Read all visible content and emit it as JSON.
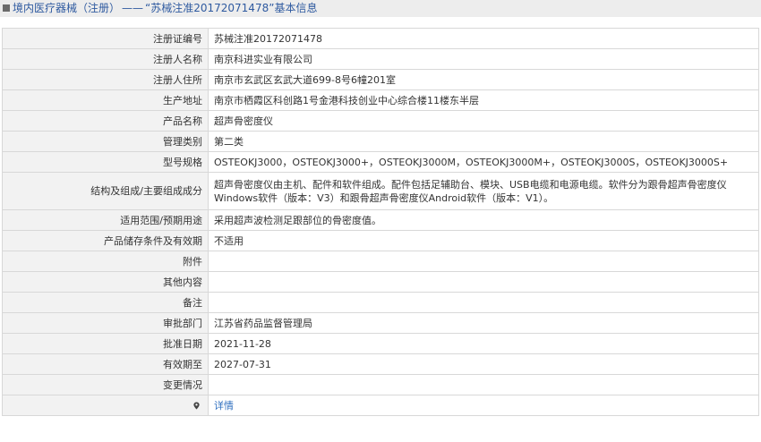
{
  "header": {
    "section": "境内医疗器械（注册）",
    "dash": "——",
    "reg_no": "“苏械注准20172071478”",
    "suffix": "基本信息"
  },
  "rows": [
    {
      "label": "注册证编号",
      "value": "苏械注准20172071478"
    },
    {
      "label": "注册人名称",
      "value": "南京科进实业有限公司"
    },
    {
      "label": "注册人住所",
      "value": "南京市玄武区玄武大道699-8号6幢201室"
    },
    {
      "label": "生产地址",
      "value": "南京市栖霞区科创路1号金港科技创业中心综合楼11楼东半层"
    },
    {
      "label": "产品名称",
      "value": "超声骨密度仪"
    },
    {
      "label": "管理类别",
      "value": "第二类"
    },
    {
      "label": "型号规格",
      "value": "OSTEOKJ3000，OSTEOKJ3000+，OSTEOKJ3000M，OSTEOKJ3000M+，OSTEOKJ3000S，OSTEOKJ3000S+"
    },
    {
      "label": "结构及组成/主要组成成分",
      "value": "超声骨密度仪由主机、配件和软件组成。配件包括足辅助台、模块、USB电缆和电源电缆。软件分为跟骨超声骨密度仪Windows软件（版本：V3）和跟骨超声骨密度仪Android软件（版本：V1）。"
    },
    {
      "label": "适用范围/预期用途",
      "value": "采用超声波检测足跟部位的骨密度值。"
    },
    {
      "label": "产品储存条件及有效期",
      "value": "不适用"
    },
    {
      "label": "附件",
      "value": ""
    },
    {
      "label": "其他内容",
      "value": ""
    },
    {
      "label": "备注",
      "value": ""
    },
    {
      "label": "审批部门",
      "value": "江苏省药品监督管理局"
    },
    {
      "label": "批准日期",
      "value": "2021-11-28"
    },
    {
      "label": "有效期至",
      "value": "2027-07-31"
    },
    {
      "label": "变更情况",
      "value": ""
    }
  ],
  "last_row": {
    "icon": "pin-icon",
    "link": "详情"
  },
  "colors": {
    "header_bg": "#ededed",
    "header_text": "#2f5aa0",
    "label_bg": "#f2f2f2",
    "border": "#d8d8d8",
    "link": "#2f6fbf"
  }
}
